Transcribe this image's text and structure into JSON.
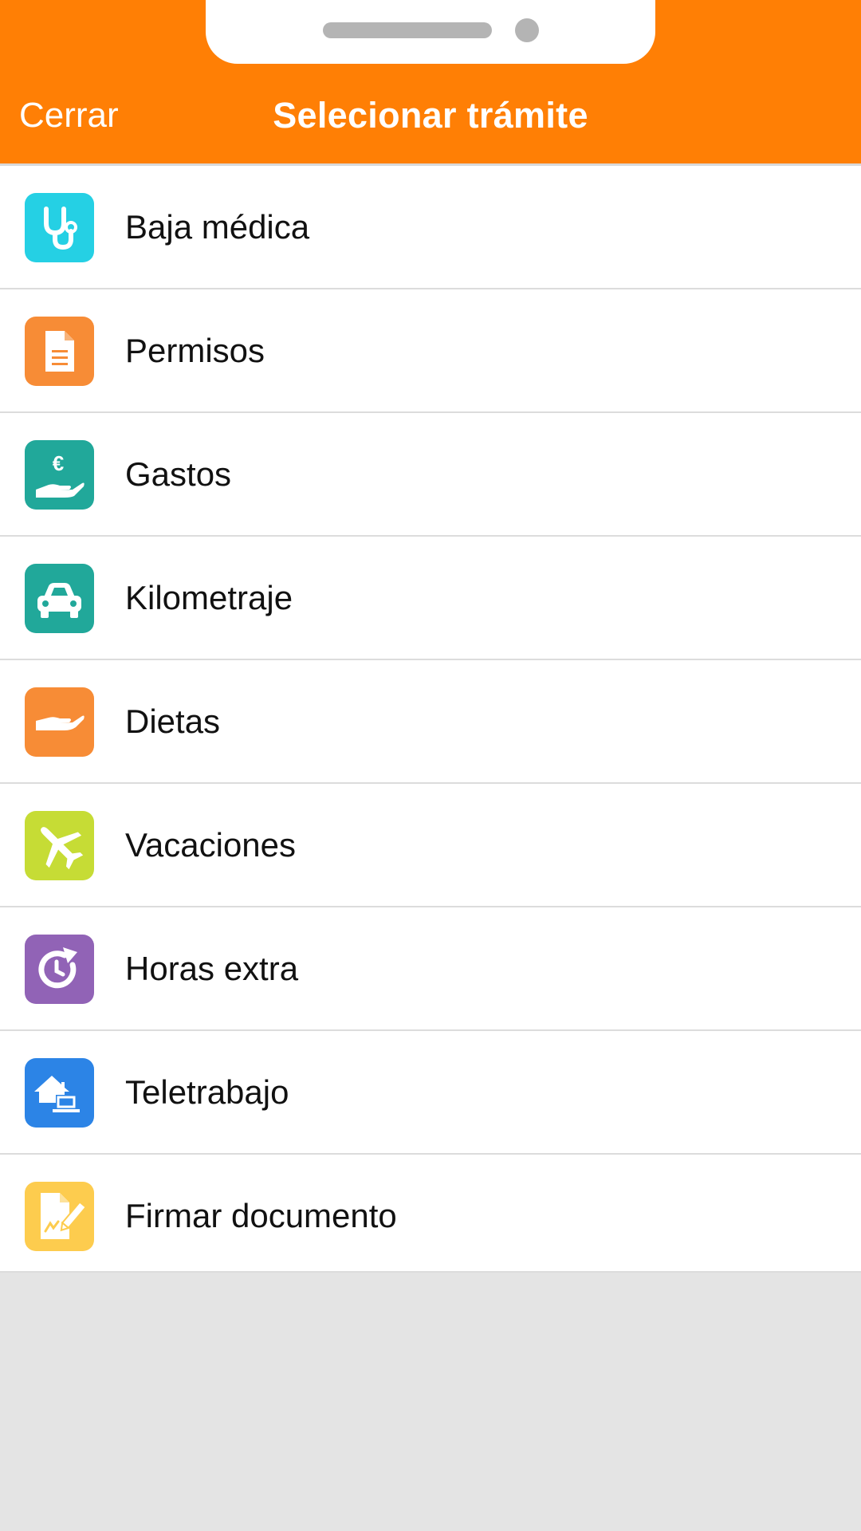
{
  "header": {
    "close_label": "Cerrar",
    "title": "Selecionar trámite",
    "color": "#ff7f05"
  },
  "items": [
    {
      "label": "Baja médica",
      "icon": "stethoscope-icon",
      "color": "#25d0e4"
    },
    {
      "label": "Permisos",
      "icon": "document-icon",
      "color": "#f78c36"
    },
    {
      "label": "Gastos",
      "icon": "euro-hand-icon",
      "color": "#21a89a"
    },
    {
      "label": "Kilometraje",
      "icon": "car-icon",
      "color": "#21a89a"
    },
    {
      "label": "Dietas",
      "icon": "hand-icon",
      "color": "#f78c36"
    },
    {
      "label": "Vacaciones",
      "icon": "airplane-icon",
      "color": "#c6dc35"
    },
    {
      "label": "Horas extra",
      "icon": "clock-arrow-icon",
      "color": "#9163b6"
    },
    {
      "label": "Teletrabajo",
      "icon": "home-laptop-icon",
      "color": "#2c84e6"
    },
    {
      "label": "Firmar documento",
      "icon": "sign-document-icon",
      "color": "#fdcc4e"
    }
  ]
}
